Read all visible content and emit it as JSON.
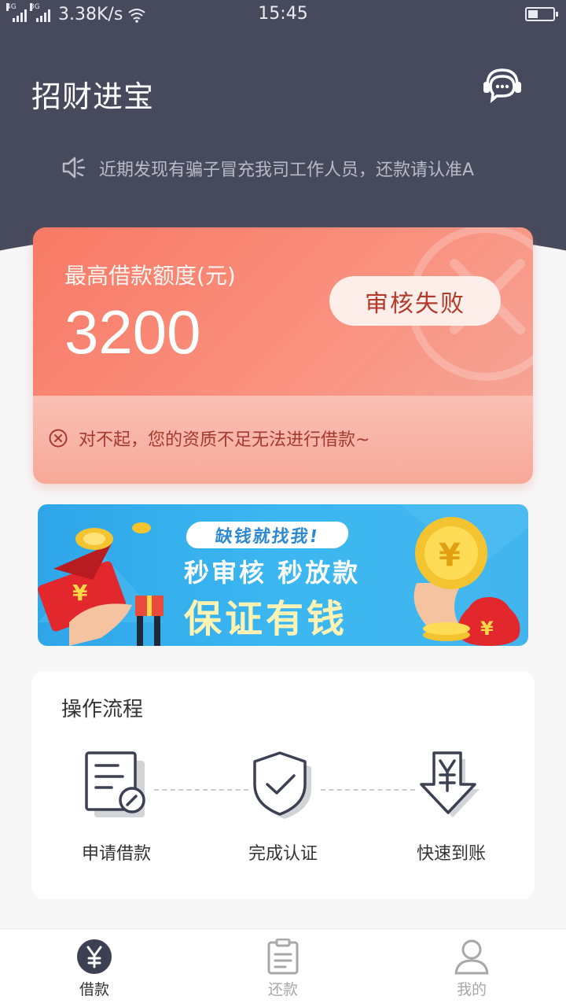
{
  "status_bar": {
    "net1": "4G",
    "net2": "3G",
    "speed": "3.38K/s",
    "time": "15:45",
    "battery_level": 0.4
  },
  "header": {
    "title": "招财进宝",
    "service_icon": "customer-service-icon"
  },
  "notice": {
    "icon": "speaker-icon",
    "text": "近期发现有骗子冒充我司工作人员，还款请认准A"
  },
  "credit_card": {
    "label": "最高借款额度(元)",
    "amount": "3200",
    "status": "审核失败",
    "reject_icon": "close-circle-icon",
    "message": "对不起，您的资质不足无法进行借款~",
    "colors": {
      "top": "#f77a66",
      "bottom": "#f9c0b4",
      "status_text": "#b23a2a"
    }
  },
  "banner": {
    "tag": "缺钱就找我!",
    "line1": "秒审核  秒放款",
    "line2": "保证有钱"
  },
  "process": {
    "title": "操作流程",
    "steps": [
      {
        "icon": "document-edit-icon",
        "label": "申请借款"
      },
      {
        "icon": "shield-check-icon",
        "label": "完成认证"
      },
      {
        "icon": "yuan-download-icon",
        "label": "快速到账"
      }
    ]
  },
  "bottom_nav": {
    "items": [
      {
        "icon": "yuan-circle-icon",
        "label": "借款",
        "active": true
      },
      {
        "icon": "clipboard-icon",
        "label": "还款",
        "active": false
      },
      {
        "icon": "user-icon",
        "label": "我的",
        "active": false
      }
    ]
  }
}
